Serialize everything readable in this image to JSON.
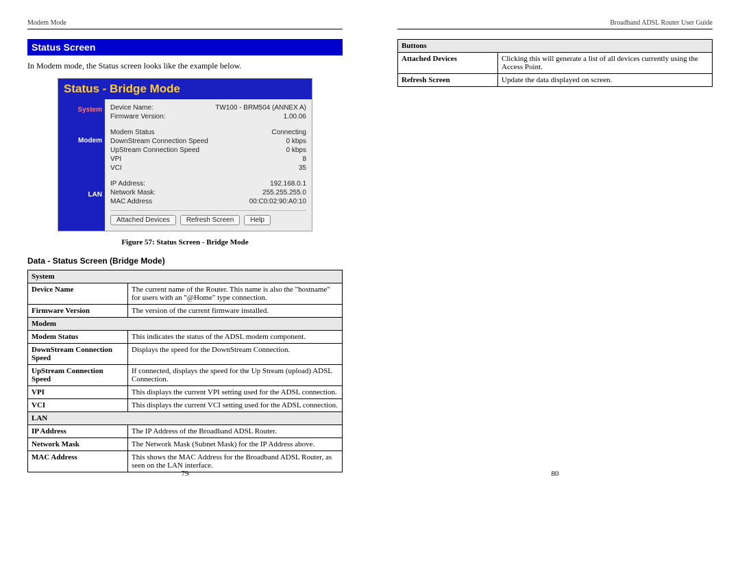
{
  "left_page": {
    "header_left": "Modem Mode",
    "section_title": "Status Screen",
    "intro": "In Modem mode, the Status screen looks like the example below.",
    "shot_title": "Status - Bridge Mode",
    "side": {
      "system": "System",
      "modem": "Modem",
      "lan": "LAN"
    },
    "system_rows": {
      "device_name_label": "Device Name:",
      "device_name_value": "TW100 - BRM504 (ANNEX A)",
      "fw_label": "Firmware Version:",
      "fw_value": "1.00.06"
    },
    "modem_rows": {
      "status_label": "Modem Status",
      "status_value": "Connecting",
      "down_label": "DownStream Connection Speed",
      "down_value": "0 kbps",
      "up_label": "UpStream Connection Speed",
      "up_value": "0 kbps",
      "vpi_label": "VPI",
      "vpi_value": "8",
      "vci_label": "VCI",
      "vci_value": "35"
    },
    "lan_rows": {
      "ip_label": "IP Address:",
      "ip_value": "192.168.0.1",
      "mask_label": "Network Mask:",
      "mask_value": "255.255.255.0",
      "mac_label": "MAC Address",
      "mac_value": "00:C0:02:90:A0:10"
    },
    "buttons": {
      "attached": "Attached Devices",
      "refresh": "Refresh Screen",
      "help": "Help"
    },
    "figure_caption": "Figure 57: Status Screen - Bridge Mode",
    "table_title": "Data - Status Screen (Bridge Mode)",
    "table": {
      "system_header": "System",
      "device_name_l": "Device Name",
      "device_name_d": "The current name of the Router. This name is also the \"hostname\" for users with an \"@Home\" type connection.",
      "fw_l": "Firmware Version",
      "fw_d": "The version of the current firmware installed.",
      "modem_header": "Modem",
      "ms_l": "Modem Status",
      "ms_d": "This indicates the status of the ADSL modem component.",
      "ds_l": "DownStream Connection Speed",
      "ds_d": "Displays the speed for the DownStream Connection.",
      "us_l": "UpStream Connection Speed",
      "us_d": "If connected, displays the speed for the Up Stream (upload) ADSL Connection.",
      "vpi_l": "VPI",
      "vpi_d": "This displays the current VPI setting used for the ADSL connection.",
      "vci_l": "VCI",
      "vci_d": "This displays the current VCI setting used for the ADSL connection.",
      "lan_header": "LAN",
      "ip_l": "IP Address",
      "ip_d": "The IP Address of the Broadband ADSL Router.",
      "nm_l": "Network Mask",
      "nm_d": "The Network Mask (Subnet Mask) for the IP Address above.",
      "mac_l": "MAC Address",
      "mac_d": "This shows the MAC Address for the Broadband ADSL Router, as seen on the LAN interface."
    },
    "page_number": "79"
  },
  "right_page": {
    "header_right": "Broadband ADSL Router User Guide",
    "table": {
      "buttons_header": "Buttons",
      "ad_l": "Attached Devices",
      "ad_d": "Clicking this will generate a list of all devices currently using the Access Point.",
      "rs_l": "Refresh Screen",
      "rs_d": "Update the data displayed on screen."
    },
    "page_number": "80"
  }
}
